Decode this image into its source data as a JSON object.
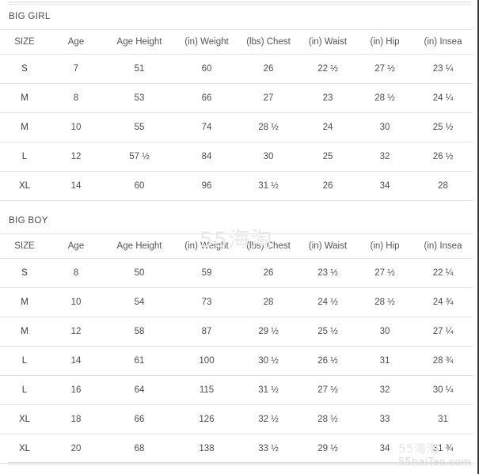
{
  "watermarks": {
    "center": "55海淘",
    "corner": "55海淘",
    "url": "55haiTao.com"
  },
  "columns": [
    "SIZE",
    "Age",
    "Age Height",
    "(in) Weight",
    "(lbs) Chest",
    "(in) Waist",
    "(in) Hip",
    "(in) Insea"
  ],
  "sections": [
    {
      "title": "BIG GIRL",
      "rows": [
        {
          "size": "S",
          "age": "7",
          "height": "51",
          "weight": "60",
          "chest": "26",
          "waist": "22 ½",
          "hip": "27 ½",
          "inseam": "23 ¼"
        },
        {
          "size": "M",
          "age": "8",
          "height": "53",
          "weight": "66",
          "chest": "27",
          "waist": "23",
          "hip": "28 ½",
          "inseam": "24 ¼"
        },
        {
          "size": "M",
          "age": "10",
          "height": "55",
          "weight": "74",
          "chest": "28 ½",
          "waist": "24",
          "hip": "30",
          "inseam": "25 ½"
        },
        {
          "size": "L",
          "age": "12",
          "height": "57 ½",
          "weight": "84",
          "chest": "30",
          "waist": "25",
          "hip": "32",
          "inseam": "26 ½"
        },
        {
          "size": "XL",
          "age": "14",
          "height": "60",
          "weight": "96",
          "chest": "31 ½",
          "waist": "26",
          "hip": "34",
          "inseam": "28"
        }
      ]
    },
    {
      "title": "BIG BOY",
      "rows": [
        {
          "size": "S",
          "age": "8",
          "height": "50",
          "weight": "59",
          "chest": "26",
          "waist": "23 ½",
          "hip": "27 ½",
          "inseam": "22 ¼"
        },
        {
          "size": "M",
          "age": "10",
          "height": "54",
          "weight": "73",
          "chest": "28",
          "waist": "24 ½",
          "hip": "28 ½",
          "inseam": "24 ¾"
        },
        {
          "size": "M",
          "age": "12",
          "height": "58",
          "weight": "87",
          "chest": "29 ½",
          "waist": "25 ½",
          "hip": "30",
          "inseam": "27 ¼"
        },
        {
          "size": "L",
          "age": "14",
          "height": "61",
          "weight": "100",
          "chest": "30 ½",
          "waist": "26 ½",
          "hip": "31",
          "inseam": "28 ¾"
        },
        {
          "size": "L",
          "age": "16",
          "height": "64",
          "weight": "115",
          "chest": "31 ½",
          "waist": "27 ½",
          "hip": "32",
          "inseam": "30 ¼"
        },
        {
          "size": "XL",
          "age": "18",
          "height": "66",
          "weight": "126",
          "chest": "32 ½",
          "waist": "28 ½",
          "hip": "33",
          "inseam": "31"
        },
        {
          "size": "XL",
          "age": "20",
          "height": "68",
          "weight": "138",
          "chest": "33 ½",
          "waist": "29 ½",
          "hip": "34",
          "inseam": "31 ¾"
        }
      ]
    }
  ]
}
